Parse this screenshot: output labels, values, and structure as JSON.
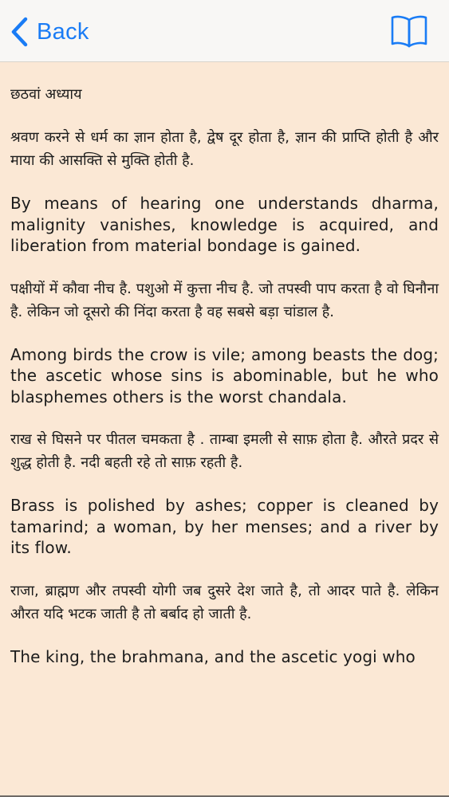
{
  "navbar": {
    "back_label": "Back",
    "back_icon": "chevron-left-icon",
    "book_icon": "open-book-icon",
    "accent_color": "#1a7cf5"
  },
  "content": {
    "chapter_title": "छठवां अध्याय",
    "paragraphs": [
      {
        "lang": "hi",
        "text": "श्रवण करने से धर्म का ज्ञान होता है, द्वेष दूर होता है, ज्ञान की प्राप्ति होती है और माया की आसक्ति से मुक्ति होती है."
      },
      {
        "lang": "en",
        "text": "By means of hearing one understands dharma, malignity vanishes, knowledge is acquired, and liberation from material bondage is gained."
      },
      {
        "lang": "hi",
        "text": "पक्षीयों में कौवा नीच है. पशुओ में कुत्ता नीच है. जो तपस्वी पाप करता है वो घिनौना है. लेकिन जो दूसरो की निंदा करता है वह सबसे बड़ा चांडाल है."
      },
      {
        "lang": "en",
        "text": "Among birds the crow is vile; among beasts the dog; the ascetic whose sins is abominable, but he who blasphemes others is the worst chandala."
      },
      {
        "lang": "hi",
        "text": "राख से घिसने पर पीतल चमकता है . ताम्बा इमली से साफ़ होता है. औरते प्रदर से शुद्ध होती है. नदी बहती रहे तो साफ़ रहती है."
      },
      {
        "lang": "en",
        "text": "Brass is polished by ashes; copper is cleaned by tamarind; a woman, by her menses; and a river by its flow."
      },
      {
        "lang": "hi",
        "text": "राजा, ब्राह्मण और तपस्वी योगी जब दुसरे देश जाते है, तो आदर पाते है. लेकिन औरत यदि भटक जाती है तो बर्बाद हो जाती है."
      },
      {
        "lang": "en",
        "text": "The king, the brahmana, and the ascetic yogi who"
      }
    ]
  }
}
